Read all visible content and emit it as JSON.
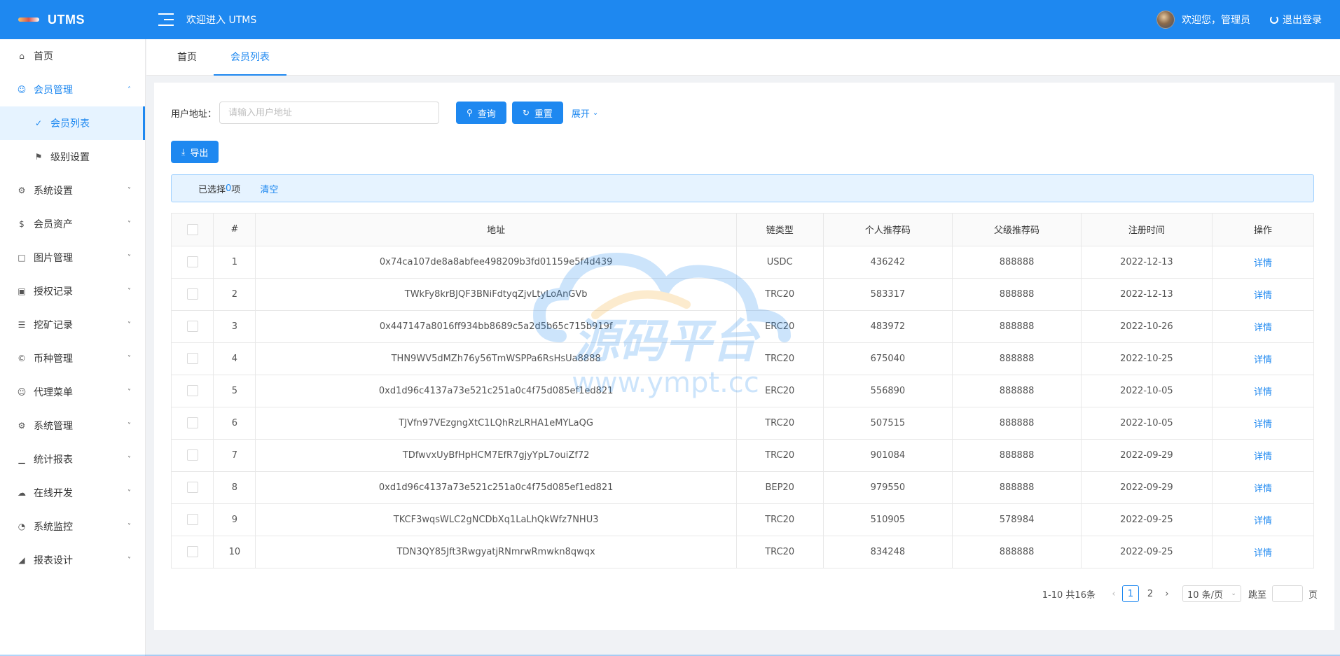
{
  "app": {
    "logo_text": "UTMS",
    "welcome_top": "欢迎进入 UTMS"
  },
  "header": {
    "greeting": "欢迎您，管理员",
    "logout": "退出登录"
  },
  "sidebar": {
    "items": [
      {
        "label": "首页",
        "icon": "home-icon"
      },
      {
        "label": "会员管理",
        "icon": "user-icon",
        "open": true
      },
      {
        "label": "会员列表",
        "icon": "check-circle-icon",
        "sub": true,
        "active": true
      },
      {
        "label": "级别设置",
        "icon": "user-level-icon",
        "sub": true
      },
      {
        "label": "系统设置",
        "icon": "gear-icon"
      },
      {
        "label": "会员资产",
        "icon": "dollar-icon"
      },
      {
        "label": "图片管理",
        "icon": "square-icon"
      },
      {
        "label": "授权记录",
        "icon": "image-icon"
      },
      {
        "label": "挖矿记录",
        "icon": "file-icon"
      },
      {
        "label": "币种管理",
        "icon": "copyright-icon"
      },
      {
        "label": "代理菜单",
        "icon": "user-icon"
      },
      {
        "label": "系统管理",
        "icon": "gear-icon"
      },
      {
        "label": "统计报表",
        "icon": "bar-chart-icon"
      },
      {
        "label": "在线开发",
        "icon": "cloud-icon"
      },
      {
        "label": "系统监控",
        "icon": "dashboard-icon"
      },
      {
        "label": "报表设计",
        "icon": "area-chart-icon"
      }
    ]
  },
  "tabs": [
    {
      "label": "首页"
    },
    {
      "label": "会员列表",
      "active": true
    }
  ],
  "search": {
    "label": "用户地址：",
    "placeholder": "请输入用户地址",
    "query_label": "查询",
    "reset_label": "重置",
    "expand_label": "展开"
  },
  "toolbar": {
    "export_label": "导出"
  },
  "selection": {
    "prefix": "已选择",
    "count": "0",
    "suffix": "项",
    "clear": "清空"
  },
  "table": {
    "columns": [
      "#",
      "地址",
      "链类型",
      "个人推荐码",
      "父级推荐码",
      "注册时间",
      "操作"
    ],
    "action_label": "详情",
    "rows": [
      {
        "idx": "1",
        "address": "0x74ca107de8a8abfee498209b3fd01159e5f4d439",
        "chain": "USDC",
        "code": "436242",
        "parent": "888888",
        "date": "2022-12-13"
      },
      {
        "idx": "2",
        "address": "TWkFy8krBJQF3BNiFdtyqZjvLtyLoAnGVb",
        "chain": "TRC20",
        "code": "583317",
        "parent": "888888",
        "date": "2022-12-13"
      },
      {
        "idx": "3",
        "address": "0x447147a8016ff934bb8689c5a2d5b65c715b919f",
        "chain": "ERC20",
        "code": "483972",
        "parent": "888888",
        "date": "2022-10-26"
      },
      {
        "idx": "4",
        "address": "THN9WV5dMZh76y56TmWSPPa6RsHsUa8888",
        "chain": "TRC20",
        "code": "675040",
        "parent": "888888",
        "date": "2022-10-25"
      },
      {
        "idx": "5",
        "address": "0xd1d96c4137a73e521c251a0c4f75d085ef1ed821",
        "chain": "ERC20",
        "code": "556890",
        "parent": "888888",
        "date": "2022-10-05"
      },
      {
        "idx": "6",
        "address": "TJVfn97VEzgngXtC1LQhRzLRHA1eMYLaQG",
        "chain": "TRC20",
        "code": "507515",
        "parent": "888888",
        "date": "2022-10-05"
      },
      {
        "idx": "7",
        "address": "TDfwvxUyBfHpHCM7EfR7gjyYpL7ouiZf72",
        "chain": "TRC20",
        "code": "901084",
        "parent": "888888",
        "date": "2022-09-29"
      },
      {
        "idx": "8",
        "address": "0xd1d96c4137a73e521c251a0c4f75d085ef1ed821",
        "chain": "BEP20",
        "code": "979550",
        "parent": "888888",
        "date": "2022-09-29"
      },
      {
        "idx": "9",
        "address": "TKCF3wqsWLC2gNCDbXq1LaLhQkWfz7NHU3",
        "chain": "TRC20",
        "code": "510905",
        "parent": "578984",
        "date": "2022-09-25"
      },
      {
        "idx": "10",
        "address": "TDN3QY85Jft3RwgyatjRNmrwRmwkn8qwqx",
        "chain": "TRC20",
        "code": "834248",
        "parent": "888888",
        "date": "2022-09-25"
      }
    ]
  },
  "pagination": {
    "total": "1-10 共16条",
    "pages": [
      "1",
      "2"
    ],
    "current": "1",
    "page_size": "10 条/页",
    "jump_label": "跳至",
    "page_suffix": "页"
  },
  "watermark": {
    "title": "源码平台",
    "url": "www.ympt.cc"
  },
  "colors": {
    "primary": "#1e88f0",
    "alert_bg": "#e6f3ff"
  }
}
